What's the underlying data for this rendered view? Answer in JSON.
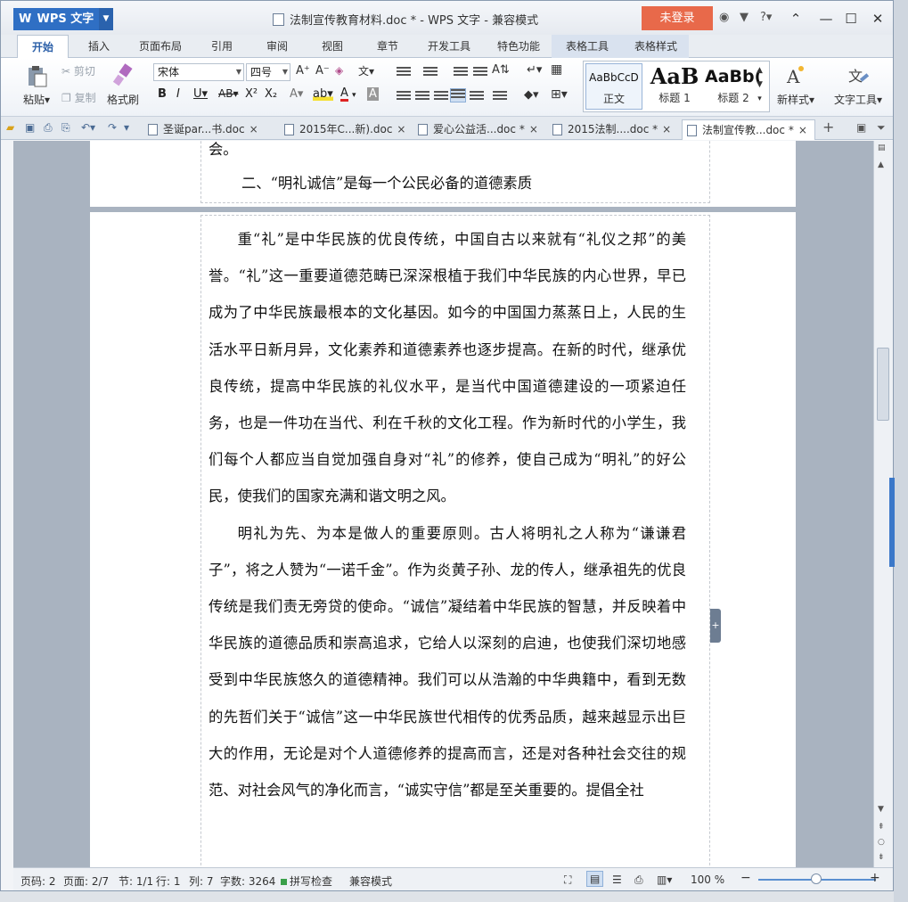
{
  "window": {
    "app_name": "WPS 文字",
    "title": "法制宣传教育材料.doc * - WPS 文字 - 兼容模式",
    "login_label": "未登录",
    "help_label": "?"
  },
  "ribbon_tabs": [
    "开始",
    "插入",
    "页面布局",
    "引用",
    "审阅",
    "视图",
    "章节",
    "开发工具",
    "特色功能",
    "表格工具",
    "表格样式"
  ],
  "ribbon": {
    "paste": "粘贴",
    "cut": "剪切",
    "copy": "复制",
    "format_painter": "格式刷",
    "font_name": "宋体",
    "font_size": "四号",
    "styles": [
      {
        "preview": "AaBbCcD",
        "name": "正文"
      },
      {
        "preview": "AaB",
        "name": "标题 1"
      },
      {
        "preview": "AaBb(",
        "name": "标题 2"
      }
    ],
    "new_style": "新样式",
    "text_tools": "文字工具"
  },
  "doc_tabs": [
    {
      "label": "圣诞par...书.doc",
      "close": "×",
      "active": false
    },
    {
      "label": "2015年C...新).doc",
      "close": "×",
      "active": false
    },
    {
      "label": "爱心公益活...doc *",
      "close": "×",
      "active": false
    },
    {
      "label": "2015法制....doc *",
      "close": "×",
      "active": false
    },
    {
      "label": "法制宣传教...doc *",
      "close": "×",
      "active": true
    }
  ],
  "document": {
    "page1_tail": "会。",
    "heading": "二、“明礼诚信”是每一个公民必备的道德素质",
    "paragraphs": [
      "重“礼”是中华民族的优良传统，中国自古以来就有“礼仪之邦”的美誉。“礼”这一重要道德范畴已深深根植于我们中华民族的内心世界，早已成为了中华民族最根本的文化基因。如今的中国国力蒸蒸日上，人民的生活水平日新月异，文化素养和道德素养也逐步提高。在新的时代，继承优良传统，提高中华民族的礼仪水平，是当代中国道德建设的一项紧迫任务，也是一件功在当代、利在千秋的文化工程。作为新时代的小学生，我们每个人都应当自觉加强自身对“礼”的修养，使自己成为“明礼”的好公民，使我们的国家充满和谐文明之风。",
      "明礼为先、为本是做人的重要原则。古人将明礼之人称为“谦谦君子”，将之人赞为“一诺千金”。作为炎黄子孙、龙的传人，继承祖先的优良传统是我们责无旁贷的使命。“诚信”凝结着中华民族的智慧，并反映着中华民族的道德品质和崇高追求，它给人以深刻的启迪，也使我们深切地感受到中华民族悠久的道德精神。我们可以从浩瀚的中华典籍中，看到无数的先哲们关于“诚信”这一中华民族世代相传的优秀品质，越来越显示出巨大的作用，无论是对个人道德修养的提高而言，还是对各种社会交往的规范、对社会风气的净化而言，“诚实守信”都是至关重要的。提倡全社"
    ]
  },
  "status_bar": {
    "page_code": "页码: 2",
    "page": "页面: 2/7",
    "section": "节: 1/1",
    "row": "行: 1",
    "col": "列: 7",
    "word_count": "字数: 3264",
    "spell_check": "拼写检查",
    "compat_mode": "兼容模式",
    "zoom": "100 %",
    "zoom_minus": "−",
    "zoom_plus": "+"
  },
  "colors": {
    "app_blue": "#2f6fc4",
    "login_orange": "#e8694a",
    "active_tab_text": "#2b5fa8"
  }
}
